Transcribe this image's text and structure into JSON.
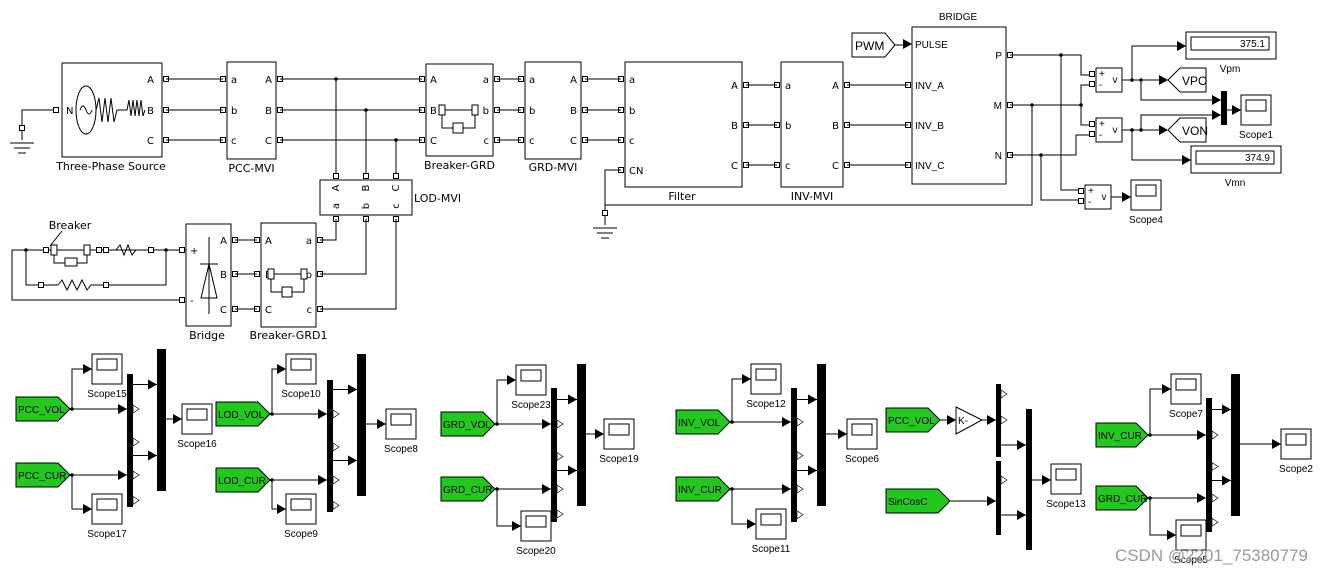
{
  "blocks": {
    "source": {
      "label": "Three-Phase Source",
      "ports": [
        "N",
        "A",
        "B",
        "C"
      ]
    },
    "pcc_mvi": {
      "label": "PCC-MVI",
      "in": [
        "a",
        "b",
        "c"
      ],
      "out": [
        "A",
        "B",
        "C"
      ]
    },
    "breaker_grd": {
      "label": "Breaker-GRD",
      "in": [
        "A",
        "B",
        "C"
      ],
      "out": [
        "a",
        "b",
        "c"
      ]
    },
    "grd_mvi": {
      "label": "GRD-MVI",
      "in": [
        "a",
        "b",
        "c"
      ],
      "out": [
        "A",
        "B",
        "C"
      ]
    },
    "filter": {
      "label": "Filter",
      "in": [
        "a",
        "b",
        "c",
        "CN"
      ],
      "out": [
        "A",
        "B",
        "C"
      ]
    },
    "inv_mvi": {
      "label": "INV-MVI",
      "in": [
        "a",
        "b",
        "c"
      ],
      "out": [
        "A",
        "B",
        "C"
      ]
    },
    "bridge_top": {
      "label": "BRIDGE",
      "in": [
        "PULSE",
        "INV_A",
        "INV_B",
        "INV_C"
      ],
      "out": [
        "P",
        "M",
        "N"
      ]
    },
    "pwm": {
      "label": "PWM"
    },
    "lod_mvi": {
      "label": "LOD-MVI",
      "top": [
        "A",
        "B",
        "C"
      ],
      "bottom": [
        "a",
        "b",
        "c"
      ]
    },
    "breaker": {
      "label": "Breaker"
    },
    "bridge_dc": {
      "label": "Bridge",
      "ports": [
        "+",
        "-",
        "A",
        "B",
        "C"
      ]
    },
    "breaker_grd1": {
      "label": "Breaker-GRD1",
      "in": [
        "A",
        "B",
        "C"
      ],
      "out": [
        "a",
        "b",
        "c"
      ]
    },
    "vsum": {
      "plus": "+",
      "minus": "-",
      "out": "v"
    },
    "vpm": {
      "label": "Vpm",
      "value": "375.1"
    },
    "vmn": {
      "label": "Vmn",
      "value": "374.9"
    },
    "vpo": {
      "label": "VPO"
    },
    "von": {
      "label": "VON"
    },
    "scope1": {
      "label": "Scope1"
    },
    "scope4": {
      "label": "Scope4"
    }
  },
  "groups": [
    {
      "tag1": "PCC_VOL",
      "tag2": "PCC_CUR",
      "scope_top": "Scope15",
      "scope_bottom": "Scope17",
      "scope_out": "Scope16"
    },
    {
      "tag1": "LOD_VOL",
      "tag2": "LOD_CUR",
      "scope_top": "Scope10",
      "scope_bottom": "Scope9",
      "scope_out": "Scope8"
    },
    {
      "tag1": "GRD_VOL",
      "tag2": "GRD_CUR",
      "scope_top": "Scope23",
      "scope_bottom": "Scope20",
      "scope_out": "Scope19"
    },
    {
      "tag1": "INV_VOL",
      "tag2": "INV_CUR",
      "scope_top": "Scope12",
      "scope_bottom": "Scope11",
      "scope_out": "Scope6"
    },
    {
      "tag1": "INV_CUR",
      "tag2": "GRD_CUR",
      "scope_top": "Scope7",
      "scope_bottom": "Scope5",
      "scope_out": "Scope2"
    }
  ],
  "sincos_group": {
    "tag1": "PCC_VOL",
    "gain": "K-",
    "tag2": "SinCosC",
    "scope": "Scope13"
  },
  "watermark": "CSDN @2201_75380779",
  "colors": {
    "goto_tag": "#22c81e",
    "background": "#ffffff",
    "line": "#000000"
  }
}
